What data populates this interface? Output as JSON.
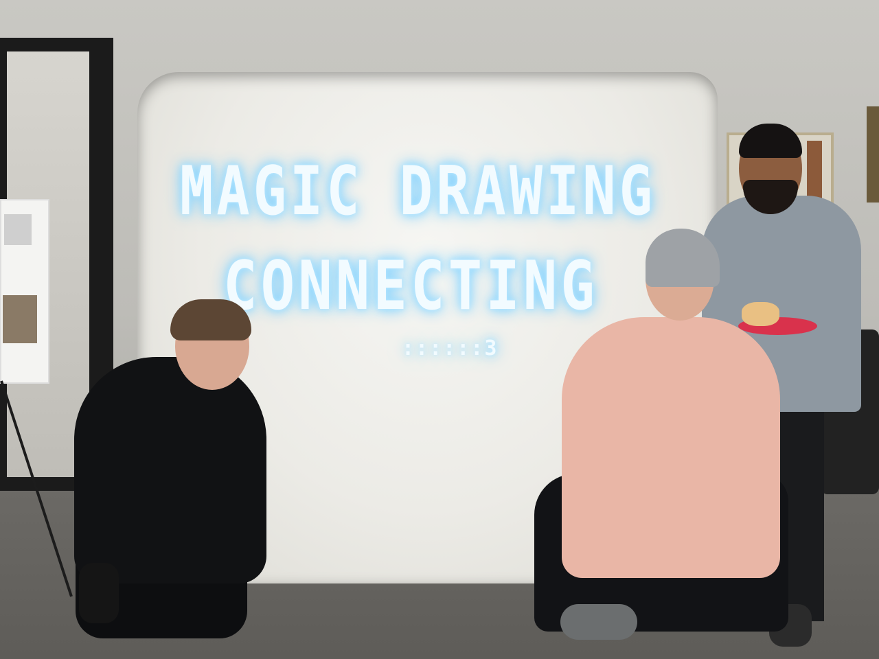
{
  "scene": {
    "description_free": true,
    "sign": {
      "line_1": "MAGIC DRAWING",
      "line_2": "CONNECTING",
      "line_3": "::::::3"
    },
    "colors": {
      "led_glow": "#8fd8ff",
      "sheet": "#ecebe6",
      "plate": "#d9324c"
    }
  }
}
